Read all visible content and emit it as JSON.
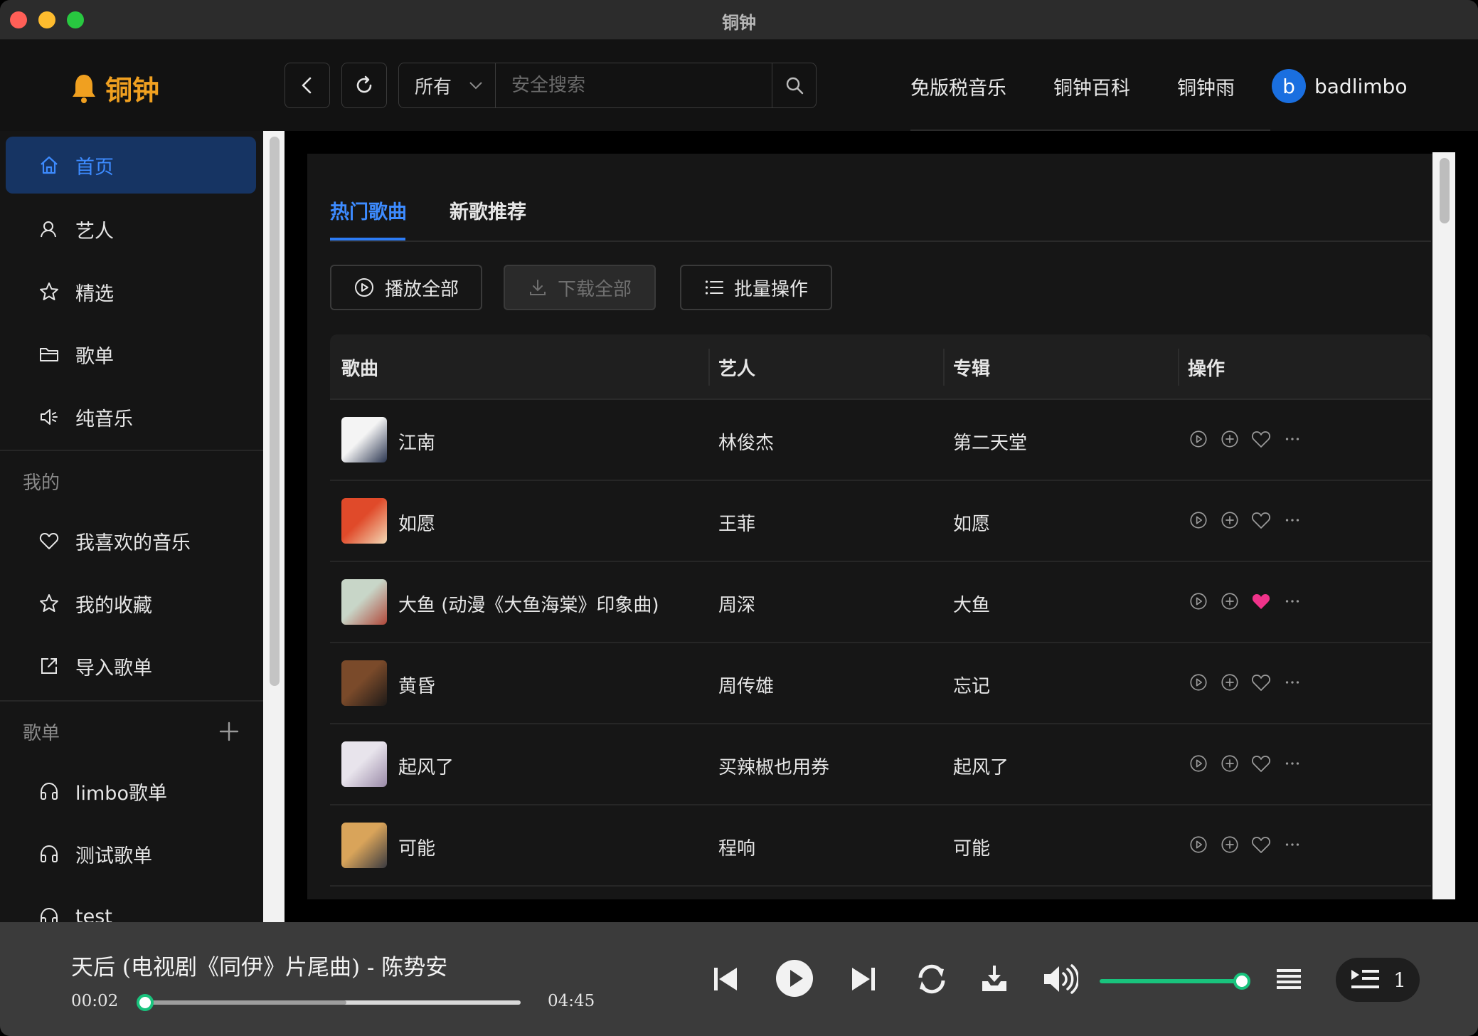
{
  "window": {
    "title": "铜钟"
  },
  "logo": {
    "text": "铜钟"
  },
  "search": {
    "scope": "所有",
    "placeholder": "安全搜索"
  },
  "top_links": [
    "免版税音乐",
    "铜钟百科",
    "铜钟雨"
  ],
  "user": {
    "initial": "b",
    "name": "badlimbo"
  },
  "sidebar": {
    "main_items": [
      {
        "label": "首页",
        "icon": "home-icon",
        "active": true
      },
      {
        "label": "艺人",
        "icon": "artist-icon"
      },
      {
        "label": "精选",
        "icon": "star-icon"
      },
      {
        "label": "歌单",
        "icon": "folder-icon"
      },
      {
        "label": "纯音乐",
        "icon": "speaker-icon"
      }
    ],
    "mine_section": "我的",
    "mine_items": [
      {
        "label": "我喜欢的音乐",
        "icon": "heart-icon"
      },
      {
        "label": "我的收藏",
        "icon": "star-icon"
      },
      {
        "label": "导入歌单",
        "icon": "import-icon"
      }
    ],
    "playlist_section": "歌单",
    "playlists": [
      {
        "label": "limbo歌单",
        "icon": "headphones-icon"
      },
      {
        "label": "测试歌单",
        "icon": "headphones-icon"
      },
      {
        "label": "test",
        "icon": "headphones-icon"
      }
    ]
  },
  "tabs": [
    "热门歌曲",
    "新歌推荐"
  ],
  "actions": {
    "play_all": "播放全部",
    "download_all": "下载全部",
    "batch": "批量操作"
  },
  "table": {
    "columns": [
      "歌曲",
      "艺人",
      "专辑",
      "操作"
    ],
    "rows": [
      {
        "song": "江南",
        "artist": "林俊杰",
        "album": "第二天堂",
        "liked": false,
        "cover": [
          "#f4f4f4",
          "#2a3550"
        ]
      },
      {
        "song": "如愿",
        "artist": "王菲",
        "album": "如愿",
        "liked": false,
        "cover": [
          "#e04a2a",
          "#f3d9b5"
        ]
      },
      {
        "song": "大鱼 (动漫《大鱼海棠》印象曲)",
        "artist": "周深",
        "album": "大鱼",
        "liked": true,
        "cover": [
          "#c8d6c8",
          "#b0473a"
        ]
      },
      {
        "song": "黄昏",
        "artist": "周传雄",
        "album": "忘记",
        "liked": false,
        "cover": [
          "#7a4a2a",
          "#1e1a18"
        ]
      },
      {
        "song": "起风了",
        "artist": "买辣椒也用券",
        "album": "起风了",
        "liked": false,
        "cover": [
          "#e8e4ec",
          "#9a8aa8"
        ]
      },
      {
        "song": "可能",
        "artist": "程响",
        "album": "可能",
        "liked": false,
        "cover": [
          "#d9a45a",
          "#3a3a40"
        ]
      }
    ]
  },
  "player": {
    "title": "天后 (电视剧《同伊》片尾曲) - 陈势安",
    "current_time": "00:02",
    "total_time": "04:45",
    "progress": 0.008,
    "buffered": 0.54,
    "volume": 1.0,
    "queue_count": "1"
  },
  "colors": {
    "accent": "#3d8bff",
    "brand": "#f0a020",
    "progress": "#19c37d",
    "liked": "#f0338a"
  }
}
